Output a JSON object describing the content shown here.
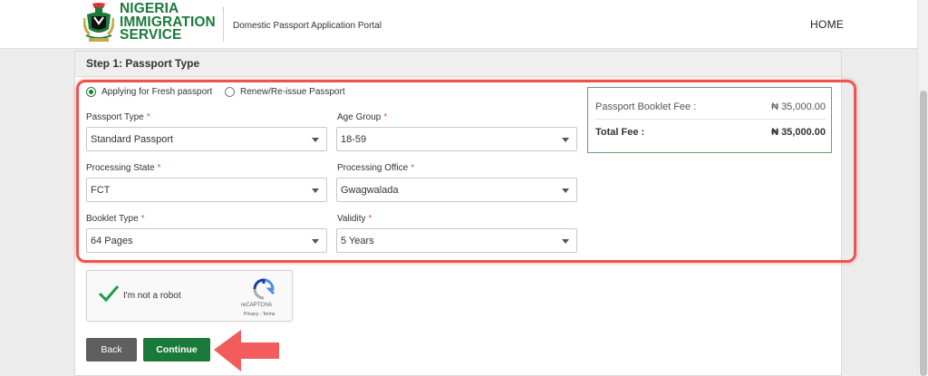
{
  "header": {
    "brand_line1": "NIGERIA",
    "brand_line2": "IMMIGRATION",
    "brand_line3": "SERVICE",
    "portal_title": "Domestic Passport Application Portal",
    "home_link": "HOME"
  },
  "step": {
    "title": "Step 1: Passport Type"
  },
  "application_type": {
    "options": [
      {
        "label": "Applying for Fresh passport",
        "selected": true
      },
      {
        "label": "Renew/Re-issue Passport",
        "selected": false
      }
    ]
  },
  "form": {
    "passport_type": {
      "label": "Passport Type",
      "required_mark": "*",
      "value": "Standard Passport"
    },
    "age_group": {
      "label": "Age Group",
      "required_mark": "*",
      "value": "18-59"
    },
    "processing_state": {
      "label": "Processing State",
      "required_mark": "*",
      "value": "FCT"
    },
    "processing_office": {
      "label": "Processing Office",
      "required_mark": "*",
      "value": "Gwagwalada"
    },
    "booklet_type": {
      "label": "Booklet Type",
      "required_mark": "*",
      "value": "64 Pages"
    },
    "validity": {
      "label": "Validity",
      "required_mark": "*",
      "value": "5 Years"
    }
  },
  "fees": {
    "booklet_fee_label": "Passport Booklet Fee :",
    "booklet_fee_value": "₦ 35,000.00",
    "total_label": "Total Fee :",
    "total_value": "₦ 35,000.00"
  },
  "captcha": {
    "text": "I'm not a robot",
    "brand": "reCAPTCHA",
    "links": "Privacy - Terms",
    "checked": true
  },
  "actions": {
    "back_label": "Back",
    "continue_label": "Continue"
  },
  "colors": {
    "brand_green": "#1b7a3a",
    "highlight_red": "#ef5350",
    "arrow_red": "#f25c5c"
  }
}
